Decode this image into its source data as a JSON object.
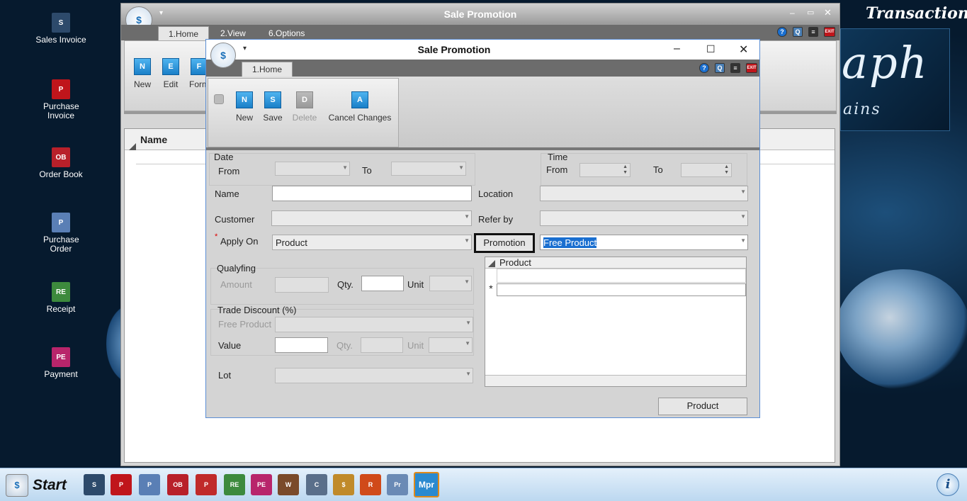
{
  "desktop": {
    "brand": {
      "title": "Transactions",
      "big": "aph",
      "small": "ains"
    },
    "icons": [
      {
        "label": "Sales Invoice",
        "icon": "sales-invoice-icon",
        "color": "#2d4a6b",
        "glyph": "S"
      },
      {
        "label": "Purchase Invoice",
        "icon": "purchase-invoice-icon",
        "color": "#c0151b",
        "glyph": "P"
      },
      {
        "label": "Order Book",
        "icon": "order-book-icon",
        "color": "#b8202a",
        "glyph": "OB"
      },
      {
        "label": "Purchase Order",
        "icon": "purchase-order-icon",
        "color": "#5a7fb5",
        "glyph": "P"
      },
      {
        "label": "Receipt",
        "icon": "receipt-icon",
        "color": "#3d8a3d",
        "glyph": "RE"
      },
      {
        "label": "Payment",
        "icon": "payment-icon",
        "color": "#b8256b",
        "glyph": "PE"
      }
    ]
  },
  "bgwin": {
    "title": "Sale Promotion",
    "tabs": [
      "1.Home",
      "2.View",
      "6.Options"
    ],
    "ribbon": [
      {
        "label": "New",
        "glyph": "N"
      },
      {
        "label": "Edit",
        "glyph": "E"
      },
      {
        "label": "Form",
        "glyph": "F"
      }
    ],
    "list_header": "Name"
  },
  "dlg": {
    "title": "Sale Promotion",
    "tab": "1.Home",
    "ribbon": [
      {
        "label": "New",
        "glyph": "N",
        "enabled": true
      },
      {
        "label": "Save",
        "glyph": "S",
        "enabled": true
      },
      {
        "label": "Delete",
        "glyph": "D",
        "enabled": false
      },
      {
        "label": "Cancel Changes",
        "glyph": "A",
        "enabled": true
      }
    ],
    "form": {
      "date_label": "Date",
      "from_label": "From",
      "to_label": "To",
      "time_label": "Time",
      "time_from_label": "From",
      "time_to_label": "To",
      "name_label": "Name",
      "name_value": "",
      "location_label": "Location",
      "customer_label": "Customer",
      "referby_label": "Refer by",
      "required_mark": "*",
      "applyon_label": "Apply On",
      "applyon_value": "Product",
      "promotion_button": "Promotion",
      "promotion_value": "Free Product",
      "qualifying_label": "Qualyfing",
      "amount_label": "Amount",
      "qty_label": "Qty.",
      "unit_label": "Unit",
      "trade_discount_label": "Trade Discount (%)",
      "free_product_label": "Free Product",
      "value_label": "Value",
      "qty2_label": "Qty.",
      "unit2_label": "Unit",
      "lot_label": "Lot",
      "grid_header": "Product",
      "new_row_marker": "*",
      "product_button": "Product"
    }
  },
  "taskbar": {
    "start_label": "Start",
    "items": [
      {
        "icon": "sales-invoice-icon",
        "color": "#2d4a6b",
        "glyph": "S"
      },
      {
        "icon": "purchase-invoice-icon",
        "color": "#c0151b",
        "glyph": "P"
      },
      {
        "icon": "purchase-order-icon",
        "color": "#5a7fb5",
        "glyph": "P"
      },
      {
        "icon": "order-book-icon",
        "color": "#b8202a",
        "glyph": "OB"
      },
      {
        "icon": "stock-icon",
        "color": "#c02a2a",
        "glyph": "P"
      },
      {
        "icon": "receipt-icon",
        "color": "#3d8a3d",
        "glyph": "RE"
      },
      {
        "icon": "payment-icon",
        "color": "#b8256b",
        "glyph": "PE"
      },
      {
        "icon": "worker-icon",
        "color": "#7a4a2a",
        "glyph": "W"
      },
      {
        "icon": "calculator-icon",
        "color": "#5a6f8a",
        "glyph": "C"
      },
      {
        "icon": "money-bag-icon",
        "color": "#c08a2a",
        "glyph": "$"
      },
      {
        "icon": "recycle-icon",
        "color": "#d04a1a",
        "glyph": "R"
      },
      {
        "icon": "printer-icon",
        "color": "#6a8ab5",
        "glyph": "Pr"
      },
      {
        "icon": "mpr-icon",
        "color": "#2a8ad0",
        "glyph": "Mpr"
      }
    ]
  }
}
